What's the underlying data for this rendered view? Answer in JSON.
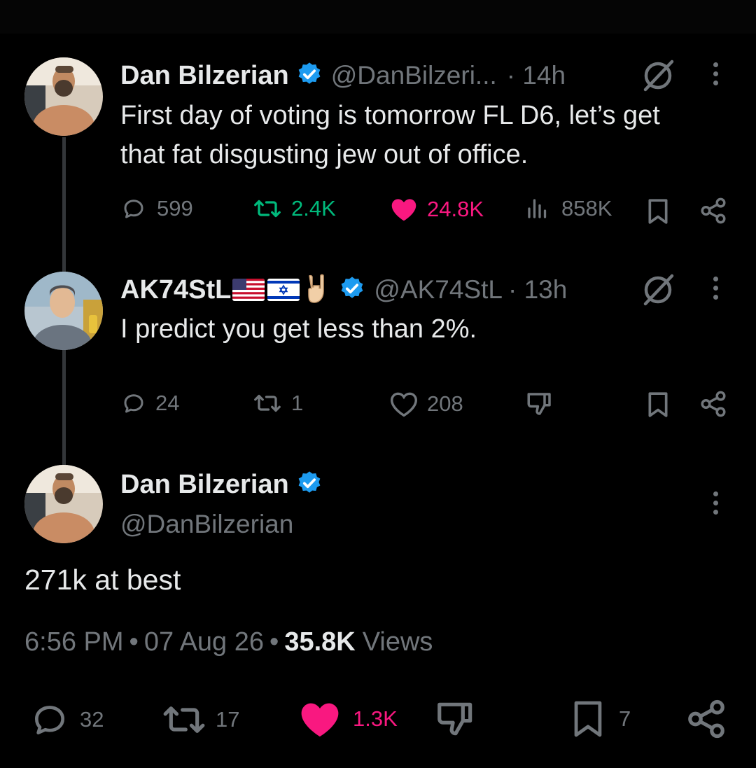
{
  "tweet1": {
    "name": "Dan Bilzerian",
    "handle": "@DanBilzeri...",
    "time": "· 14h",
    "text_line1": "First day of voting is tomorrow FL D6, let’s get",
    "text_line2": "that fat disgusting jew out of office.",
    "replies": "599",
    "retweets": "2.4K",
    "likes": "24.8K",
    "views": "858K",
    "retweet_color": "#00ba7c",
    "like_color": "#f91880"
  },
  "tweet2": {
    "name": "AK74StL",
    "handle": "@AK74StL",
    "time": "· 13h",
    "text": "I predict you get less than 2%.",
    "replies": "24",
    "retweets": "1",
    "likes": "208"
  },
  "main": {
    "name": "Dan Bilzerian",
    "handle": "@DanBilzerian",
    "text": "271k at best",
    "time": "6:56 PM",
    "date": "07 Aug 26",
    "sep": "•",
    "views_count": "35.8K",
    "views_label": "Views",
    "replies": "32",
    "retweets": "17",
    "likes": "1.3K",
    "bookmarks": "7",
    "like_color": "#f91880"
  },
  "colors": {
    "verified": "#1d9bf0",
    "muted": "#71767b",
    "text": "#e7e9ea"
  },
  "icons": [
    "reply-icon",
    "retweet-icon",
    "like-icon",
    "views-icon",
    "bookmark-icon",
    "share-icon",
    "dislike-icon",
    "grok-slash-icon",
    "more-icon",
    "verified-icon"
  ]
}
